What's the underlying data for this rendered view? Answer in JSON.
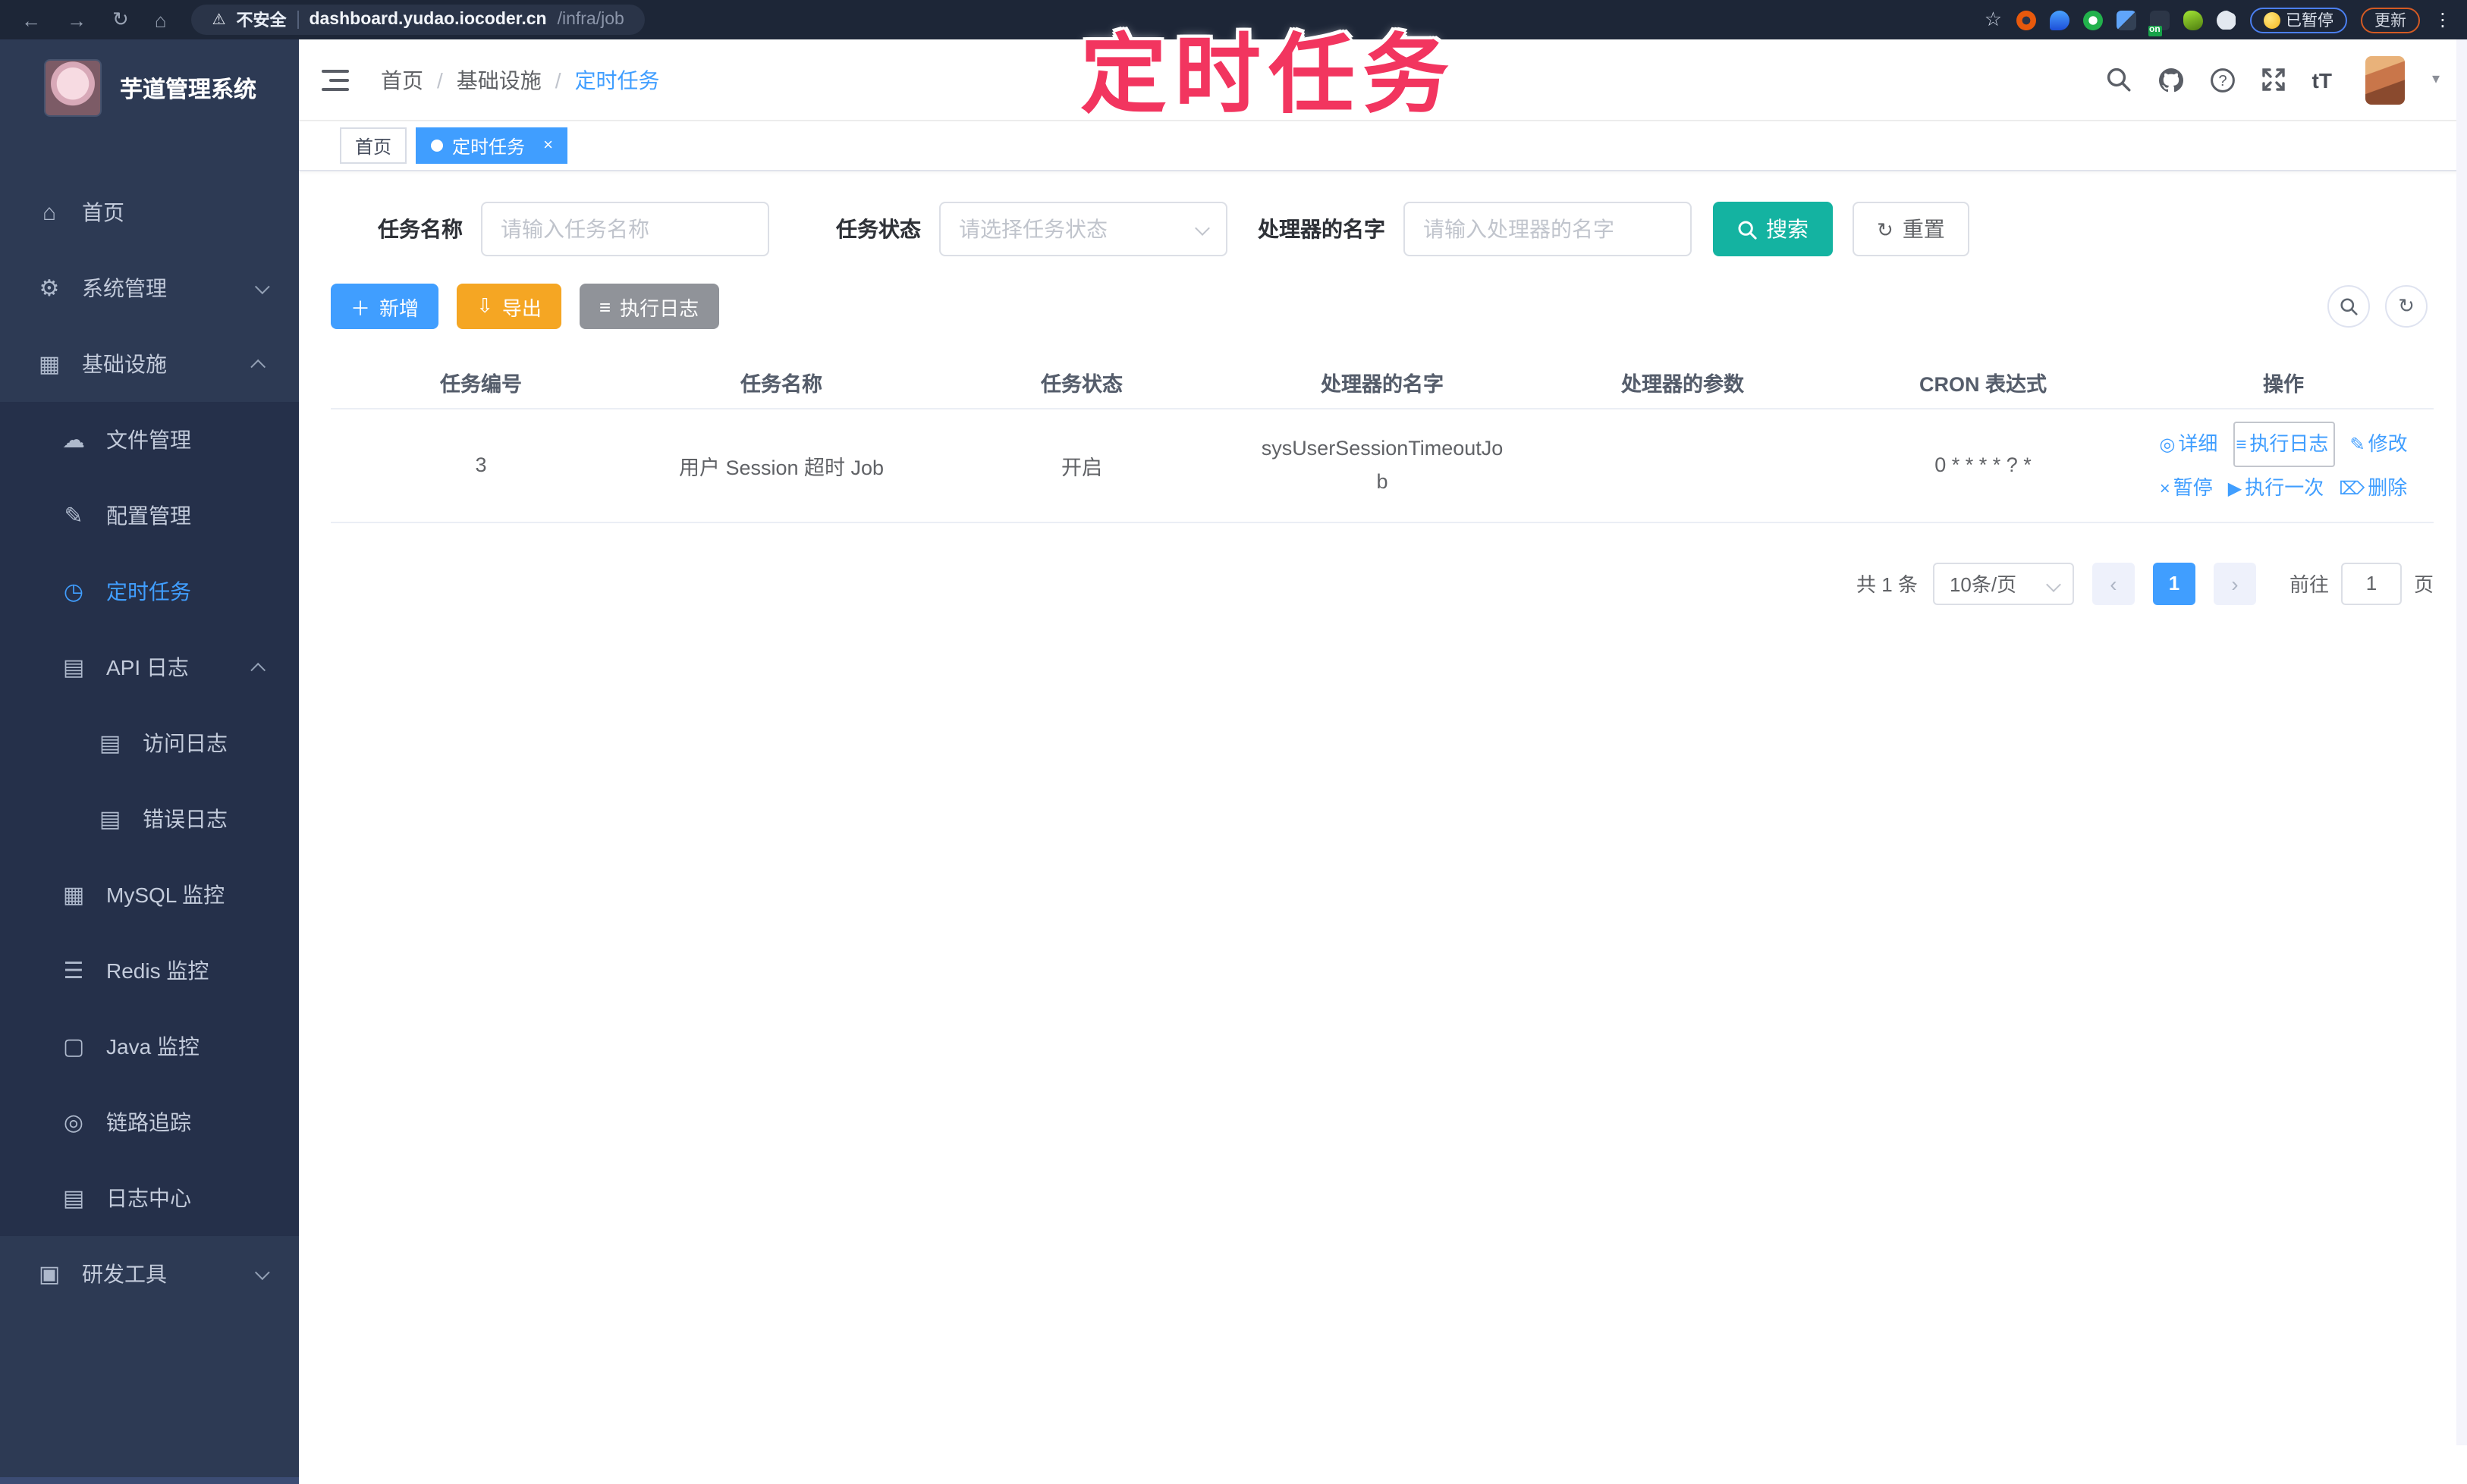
{
  "browser": {
    "security_label": "不安全",
    "url_host": "dashboard.yudao.iocoder.cn",
    "url_path": "/infra/job",
    "extension_badge": "on",
    "paused_chip": "已暂停",
    "update_chip": "更新"
  },
  "annotation": {
    "title": "定时任务"
  },
  "icons": {
    "back": "←",
    "forward": "→",
    "reload": "↻",
    "home": "⌂",
    "warning": "⚠",
    "star": "☆",
    "kebab": "⋮",
    "caret": "▾",
    "plus": "＋",
    "download": "⇩",
    "list": "≡",
    "refresh": "↻",
    "detail": "◎",
    "edit": "✎",
    "pause": "×",
    "run": "▶",
    "trash": "⌦",
    "prev": "‹",
    "next": "›"
  },
  "sidebar": {
    "app_title": "芋道管理系统",
    "items": [
      {
        "label": "首页",
        "icon": "⌂"
      },
      {
        "label": "系统管理",
        "icon": "⚙"
      },
      {
        "label": "基础设施",
        "icon": "▦"
      },
      {
        "label": "文件管理",
        "icon": "☁"
      },
      {
        "label": "配置管理",
        "icon": "✎"
      },
      {
        "label": "定时任务",
        "icon": "◷"
      },
      {
        "label": "API 日志",
        "icon": "▤"
      },
      {
        "label": "访问日志",
        "icon": "▤"
      },
      {
        "label": "错误日志",
        "icon": "▤"
      },
      {
        "label": "MySQL 监控",
        "icon": "▦"
      },
      {
        "label": "Redis 监控",
        "icon": "☰"
      },
      {
        "label": "Java 监控",
        "icon": "▢"
      },
      {
        "label": "链路追踪",
        "icon": "◎"
      },
      {
        "label": "日志中心",
        "icon": "▤"
      },
      {
        "label": "研发工具",
        "icon": "▣"
      }
    ]
  },
  "header": {
    "breadcrumb": {
      "0": "首页",
      "1": "基础设施",
      "2": "定时任务"
    },
    "font_label": "tT"
  },
  "tags": {
    "home": "首页",
    "active": "定时任务",
    "close": "×"
  },
  "filters": {
    "name_label": "任务名称",
    "name_placeholder": "请输入任务名称",
    "status_label": "任务状态",
    "status_placeholder": "请选择任务状态",
    "handler_label": "处理器的名字",
    "handler_placeholder": "请输入处理器的名字",
    "search_label": "搜索",
    "reset_label": "重置"
  },
  "toolbar": {
    "add_label": "新增",
    "export_label": "导出",
    "exec_log_label": "执行日志"
  },
  "table": {
    "headers": [
      "任务编号",
      "任务名称",
      "任务状态",
      "处理器的名字",
      "处理器的参数",
      "CRON 表达式",
      "操作"
    ],
    "rows": [
      {
        "id": "3",
        "name": "用户 Session 超时 Job",
        "status": "开启",
        "handler": "sysUserSessionTimeoutJob",
        "param": "",
        "cron": "0 * * * * ? *",
        "ops": [
          "详细",
          "执行日志",
          "修改",
          "暂停",
          "执行一次",
          "删除"
        ]
      }
    ]
  },
  "pagination": {
    "total": "共 1 条",
    "page_size": "10条/页",
    "current_page": "1",
    "goto_label": "前往",
    "goto_value": "1",
    "page_label": "页"
  },
  "colors": {
    "primary": "#409eff",
    "sidebar_bg": "#2d3a54",
    "submenu_bg": "#25304a",
    "search_button": "#14b3a1",
    "export_button": "#f5a623",
    "gray_button": "#909399",
    "annotation_pink": "#f2355f",
    "browser_bar": "#1d2637"
  }
}
